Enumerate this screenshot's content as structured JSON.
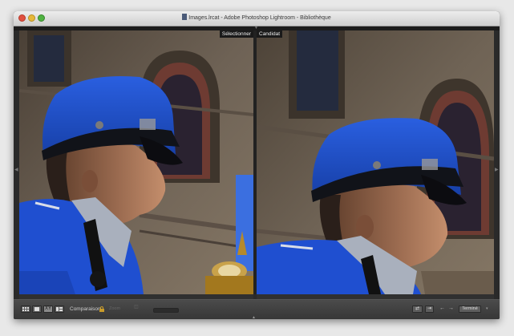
{
  "window": {
    "title": "Images.lrcat - Adobe Photoshop Lightroom - Bibliothèque"
  },
  "compare": {
    "select_label": "Sélectionner",
    "candidate_label": "Candidat"
  },
  "toolbar": {
    "view_buttons": [
      {
        "icon": "grid-view-icon",
        "active": false
      },
      {
        "icon": "loupe-view-icon",
        "active": false
      },
      {
        "icon": "compare-view-icon",
        "label": "XY",
        "active": true
      },
      {
        "icon": "survey-view-icon",
        "active": false
      }
    ],
    "mode_label": "Comparaison",
    "zoom_label": "Zoom",
    "swap_icon": "swap-icon",
    "select_button_icon": "make-select-icon",
    "prev_icon": "arrow-left-icon",
    "next_icon": "arrow-right-icon",
    "done_label": "Terminé"
  },
  "colors": {
    "uniform_blue": "#1f4fd0",
    "sky_blue": "#3b6fe0",
    "toolbar_bg": "#3f3f3f",
    "lock_gold": "#c99b2a"
  }
}
